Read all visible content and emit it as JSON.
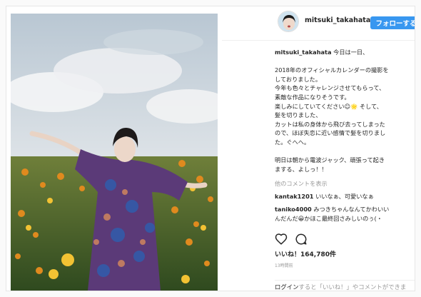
{
  "header": {
    "username": "mitsuki_takahata",
    "follow_label": "フォローする"
  },
  "caption": {
    "username": "mitsuki_takahata",
    "first_line": "今日は一日、",
    "lines": [
      "",
      "2018年のオフィシャルカレンダーの撮影を",
      "しておりました。",
      "今年も色々とチャレンジさせてもらって、",
      "素敵な作品になりそうです。",
      "楽しみにしていてください☺🌟 そして、",
      "髪を切りました、",
      "カットは私の身体から飛び去ってしまった",
      "ので、ほぼ失恋に近い感情で髪を切りまし",
      "た。ぐへへ。",
      "",
      "明日は朝から電波ジャック、頑張って起き",
      "まする、よしっ！！"
    ]
  },
  "comments": {
    "more_label": "他のコメントを表示",
    "items": [
      {
        "user": "kantak1201",
        "text": "いいなぁ、可愛いなぁ"
      },
      {
        "user": "taniko4000",
        "text": "みつきちゃんなんてかわいい"
      },
      {
        "user": "",
        "text": "んだんだ😀かほこ最終回さみしいのぅ(・"
      }
    ]
  },
  "actions": {
    "likes_label": "いいね！164,780件",
    "time_label": "13時間前"
  },
  "login": {
    "link_label": "ログイン",
    "text": "すると「いいね！」やコメントができます。"
  },
  "icons": [
    "heart-icon",
    "comment-icon",
    "verified-badge-icon"
  ],
  "colors": {
    "accent": "#3897f0",
    "text": "#262626",
    "muted": "#999999"
  }
}
